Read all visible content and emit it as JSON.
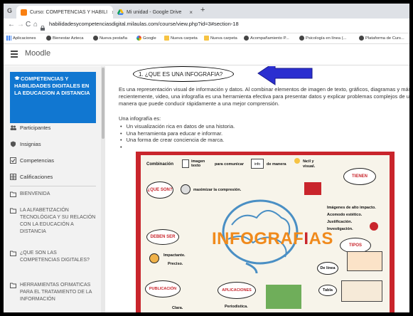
{
  "browser": {
    "tabs": [
      {
        "title": "Curso: COMPETENCIAS Y HABILI",
        "active": true
      },
      {
        "title": "Mi unidad - Google Drive",
        "active": false
      }
    ],
    "first_tab_letter": "G",
    "new_tab_symbol": "+",
    "close_symbol": "×",
    "url": "habilidadesycompetenciasdigital.milaulas.com/course/view.php?id=3#section-18",
    "bookmarks": [
      {
        "label": "Aplicaciones",
        "icon": "apps-grid-icon"
      },
      {
        "label": "Bienestar Azteca",
        "icon": "site-globe-icon"
      },
      {
        "label": "Nueva pestaña",
        "icon": "site-globe-icon"
      },
      {
        "label": "Google",
        "icon": "google-icon"
      },
      {
        "label": "Nueva carpeta",
        "icon": "folder-icon"
      },
      {
        "label": "Nueva carpeta",
        "icon": "folder-icon"
      },
      {
        "label": "Acompañamiento P...",
        "icon": "site-globe-icon"
      },
      {
        "label": "Psicología en línea (...",
        "icon": "site-globe-icon"
      },
      {
        "label": "Plataforma de Curs...",
        "icon": "site-globe-icon"
      }
    ]
  },
  "header": {
    "brand": "Moodle"
  },
  "drawer": {
    "course_title": "COMPETENCIAS Y HABILIDADES DIGITALES EN LA EDUCACION A DISTANCIA",
    "items": [
      {
        "label": "Participantes",
        "icon": "users-icon"
      },
      {
        "label": "Insignias",
        "icon": "badge-icon"
      },
      {
        "label": "Competencias",
        "icon": "checkbox-icon"
      },
      {
        "label": "Calificaciones",
        "icon": "table-icon"
      }
    ],
    "sections": [
      {
        "label": "BIENVENIDA"
      },
      {
        "label": "LA ALFABETIZACIÓN TECNOLÓGICA Y SU RELACIÓN CON LA EDUCACIÓN A DISTANCIA"
      },
      {
        "label": "¿QUE SON LAS COMPETENCIAS DIGITALES?"
      },
      {
        "label": "HERRAMIENTAS OFIMATICAS PARA EL TRATAMIENTO DE LA INFORMACIÓN"
      }
    ]
  },
  "main": {
    "section_title": "1. ¿QUE ES UNA INFOGRAFIA?",
    "paragraph": "Es una representación visual de información y datos. Al combinar elementos de imagen de texto, gráficos, diagramas y más recientemente, video, una infografía es una herramienta efectiva para presentar datos y explicar problemas complejos de una manera que puede conducir rápidamente a una mejor comprensión.",
    "list_heading": "Una infografía es:",
    "list_items": [
      "Un visualización rica en datos de una historia.",
      "Una herramienta para educar e informar.",
      "Una forma de crear conciencia de marca.",
      ""
    ],
    "arrow_color": "#2b2fd0",
    "infographic": {
      "title_before": "INFOGRAF",
      "title_accent": "I",
      "title_after": "AS",
      "combinacion": "Combinación",
      "imagen_texto": "imagen texto",
      "para_comunicar": "para comunicar",
      "info": "info",
      "de_manera": "de manera",
      "facil_visual": "fácil y visual.",
      "tienen": "TIENEN",
      "que_son": "¿QUE SON?",
      "maximizar": "maximizar la compresión.",
      "imagenes_impacto": "Imágenes de alto impacto.",
      "acomodo": "Acomodo estético.",
      "justificacion": "Justificación.",
      "investigacion": "Investigación.",
      "deben_ser": "DEBEN SER",
      "impactante": "Impactante.",
      "preciso": "Preciso.",
      "tipos": "TIPOS",
      "de_linea": "De línea",
      "publicacion": "PUBLICACIÓN",
      "aplicaciones": "APLICACIONES",
      "tabla": "Tabla",
      "clara": "Clara.",
      "periodistica": "Periodística."
    }
  }
}
